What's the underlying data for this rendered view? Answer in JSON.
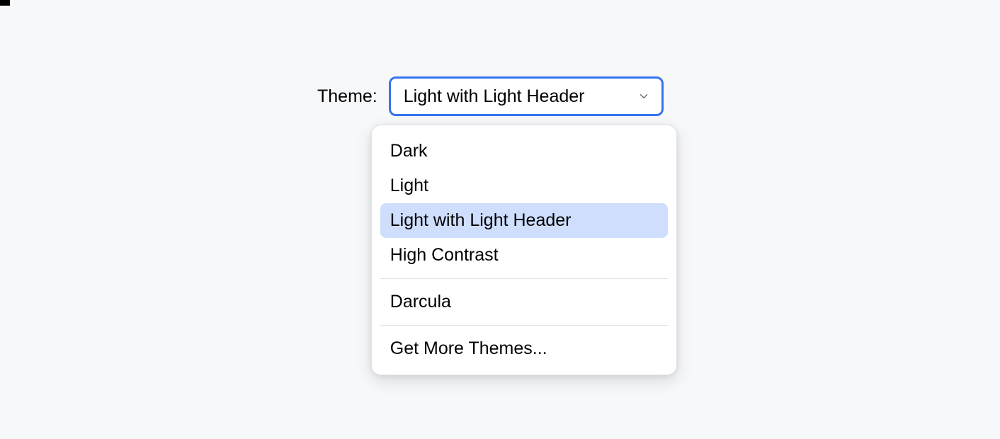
{
  "label": "Theme:",
  "selected": "Light with Light Header",
  "groups": [
    {
      "items": [
        {
          "label": "Dark",
          "selected": false
        },
        {
          "label": "Light",
          "selected": false
        },
        {
          "label": "Light with Light Header",
          "selected": true
        },
        {
          "label": "High Contrast",
          "selected": false
        }
      ]
    },
    {
      "items": [
        {
          "label": "Darcula",
          "selected": false
        }
      ]
    },
    {
      "items": [
        {
          "label": "Get More Themes...",
          "selected": false
        }
      ]
    }
  ]
}
